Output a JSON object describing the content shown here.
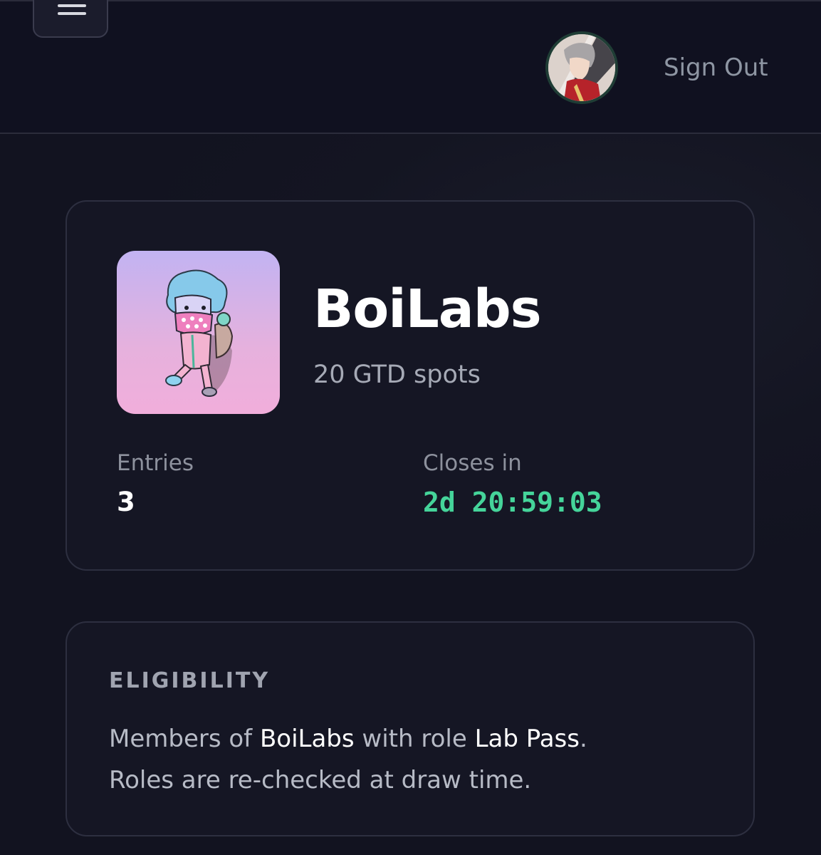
{
  "header": {
    "menu_icon": "hamburger-menu-icon",
    "avatar_icon": "user-avatar",
    "sign_out_label": "Sign Out"
  },
  "project": {
    "image_icon": "boilabs-project-image",
    "title": "BoiLabs",
    "spots": "20 GTD spots",
    "entries_label": "Entries",
    "entries_value": "3",
    "closes_label": "Closes in",
    "closes_value": "2d 20:59:03"
  },
  "eligibility": {
    "heading": "ELIGIBILITY",
    "text_part1": "Members of ",
    "server": "BoiLabs",
    "text_part2": " with role ",
    "role": "Lab Pass",
    "text_part3": ".",
    "note": "Roles are re-checked at draw time."
  },
  "colors": {
    "background": "#12131f",
    "countdown": "#45d49a",
    "muted_text": "#8d919d"
  }
}
